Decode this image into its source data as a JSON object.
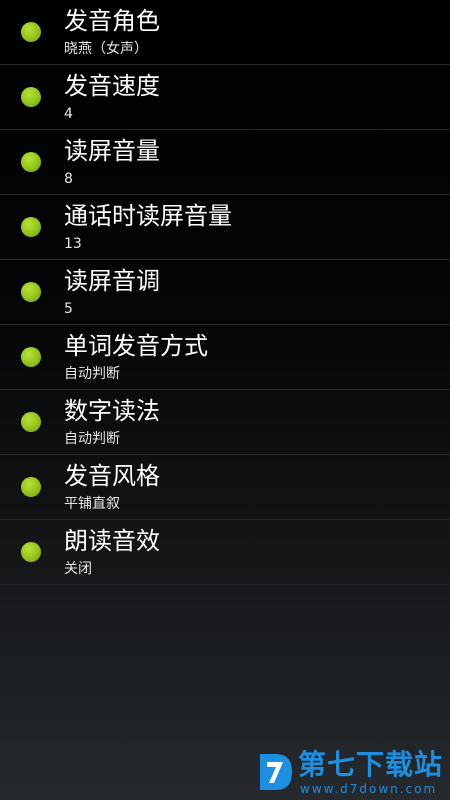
{
  "settings": {
    "items": [
      {
        "title": "发音角色",
        "value": "晓燕（女声）"
      },
      {
        "title": "发音速度",
        "value": "4"
      },
      {
        "title": "读屏音量",
        "value": "8"
      },
      {
        "title": "通话时读屏音量",
        "value": "13"
      },
      {
        "title": "读屏音调",
        "value": "5"
      },
      {
        "title": "单词发音方式",
        "value": "自动判断"
      },
      {
        "title": "数字读法",
        "value": "自动判断"
      },
      {
        "title": "发音风格",
        "value": "平铺直叙"
      },
      {
        "title": "朗读音效",
        "value": "关闭"
      }
    ],
    "indicator_color": "#9ccd20"
  },
  "watermark": {
    "name": "第七下载站",
    "url": "www.d7down.com",
    "color": "#1d8fe0"
  }
}
